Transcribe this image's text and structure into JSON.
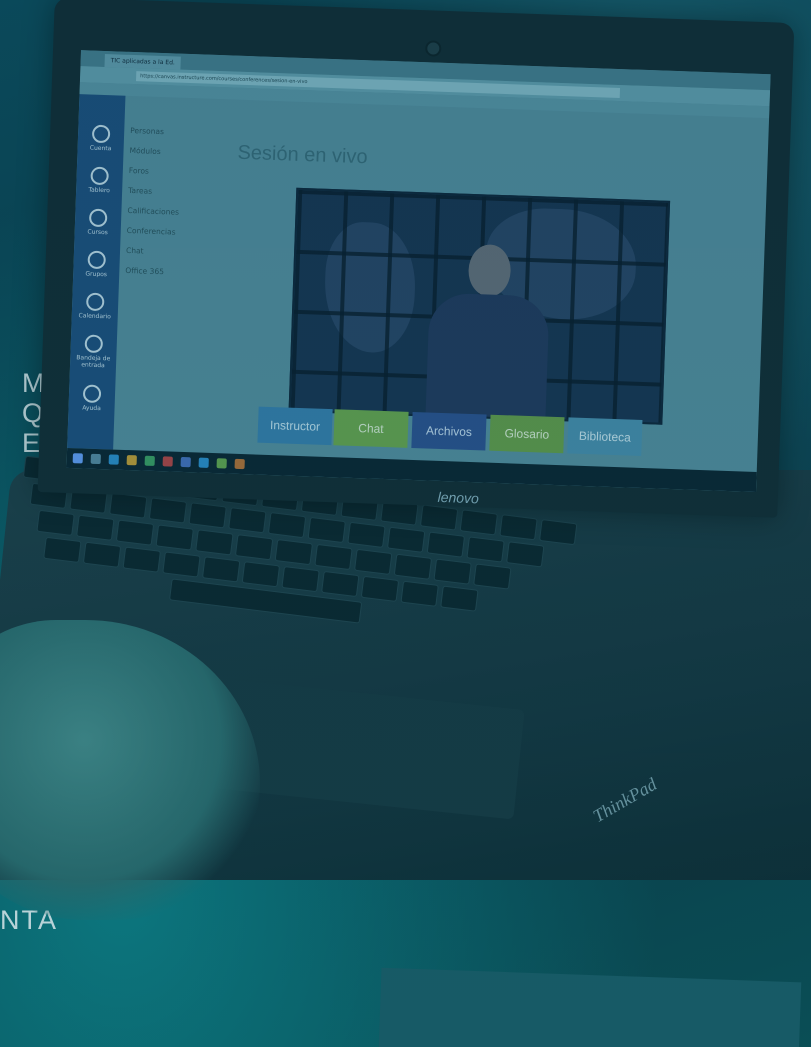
{
  "background_text": {
    "line1": "MITE",
    "line2": "QUE",
    "line3": "ES,",
    "line4": "NTA"
  },
  "browser": {
    "tab_label": "TIC aplicadas a la Ed.",
    "address": "https://canvas.instructure.com/courses/conferences/sesion-en-vivo"
  },
  "lms": {
    "nav": [
      {
        "label": "Cuenta",
        "icon": "user-icon"
      },
      {
        "label": "Tablero",
        "icon": "dashboard-icon"
      },
      {
        "label": "Cursos",
        "icon": "book-icon"
      },
      {
        "label": "Grupos",
        "icon": "group-icon"
      },
      {
        "label": "Calendario",
        "icon": "calendar-icon"
      },
      {
        "label": "Bandeja de entrada",
        "icon": "inbox-icon"
      },
      {
        "label": "Ayuda",
        "icon": "help-icon"
      }
    ],
    "course_menu": [
      "Personas",
      "Módulos",
      "Foros",
      "Tareas",
      "Calificaciones",
      "Conferencias",
      "Chat",
      "Office 365"
    ],
    "page_title": "Sesión en vivo",
    "actions": [
      {
        "label": "Instructor",
        "color": "#3a7fb0"
      },
      {
        "label": "Chat",
        "color": "#6fa84a"
      },
      {
        "label": "Archivos",
        "color": "#2f4f8f"
      },
      {
        "label": "Glosario",
        "color": "#6a9e45"
      },
      {
        "label": "Biblioteca",
        "color": "#4d8fb0"
      }
    ]
  },
  "laptop": {
    "brand": "lenovo",
    "logo": "ThinkPad"
  },
  "colors": {
    "tint": "#0b3a4a",
    "accent": "#0f7f86"
  }
}
